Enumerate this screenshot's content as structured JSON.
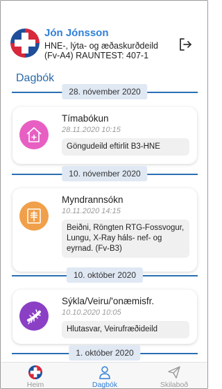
{
  "header": {
    "user_name": "Jón Jónsson",
    "department_line1": "HNE-, lýta- og æðaskurðdeild",
    "department_line2": "(Fv-A4) RAUNTEST: 407-1",
    "avatar_icon": "hospital-cross-icon",
    "logout_icon": "logout-icon"
  },
  "page": {
    "title": "Dagbók"
  },
  "feed": [
    {
      "date": "28. nóvember 2020",
      "title": "Tímabókun",
      "time": "28.11.2020 10:15",
      "description": "Göngudeild eftirlit B3-HNE",
      "icon": "house-plus-icon",
      "icon_color": "#e85fc3"
    },
    {
      "date": "10. nóvember 2020",
      "title": "Myndrannsókn",
      "time": "10.11.2020 14:15",
      "description": "Beiðni, Röngten RTG-Fossvogur, Lungu, X-Ray háls- nef- og eyrnad. (Fv-B3)",
      "icon": "xray-icon",
      "icon_color": "#f0a04a"
    },
    {
      "date": "10. október 2020",
      "title": "Sýkla/Veiru/'onæmisfr.",
      "time": "10.10.2020 10:05",
      "description": "Hlutasvar, Veirufræðideild",
      "icon": "bacteria-icon",
      "icon_color": "#8a3fc4"
    },
    {
      "date": "1. október 2020"
    }
  ],
  "bottom_nav": [
    {
      "label": "Heim",
      "icon": "hospital-cross-icon",
      "active": false
    },
    {
      "label": "Dagbók",
      "icon": "person-icon",
      "active": true
    },
    {
      "label": "Skilaboð",
      "icon": "send-icon",
      "active": false
    }
  ],
  "colors": {
    "accent": "#2f7fd6",
    "separator_line": "#2a6fb3",
    "date_pill": "#dfe8f3",
    "logo_red": "#d8283a",
    "logo_blue": "#1f4f9a"
  }
}
